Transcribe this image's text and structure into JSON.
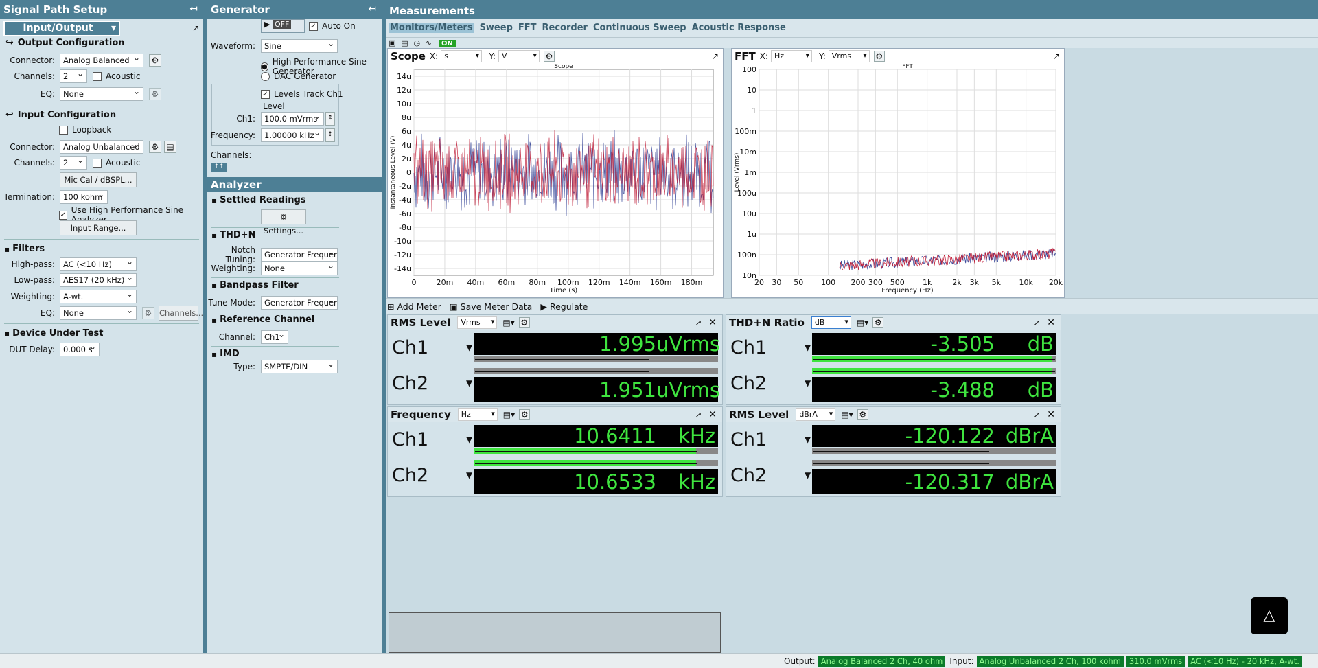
{
  "signal_path": {
    "title": "Signal Path Setup",
    "mode": "Input/Output",
    "output_config": {
      "title": "Output Configuration",
      "connector_label": "Connector:",
      "connector": "Analog Balanced",
      "channels_label": "Channels:",
      "channels": "2",
      "acoustic": "Acoustic",
      "eq_label": "EQ:",
      "eq": "None"
    },
    "input_config": {
      "title": "Input Configuration",
      "loopback": "Loopback",
      "connector_label": "Connector:",
      "connector": "Analog Unbalanced",
      "channels_label": "Channels:",
      "channels": "2",
      "acoustic": "Acoustic",
      "mic_cal": "Mic Cal / dBSPL...",
      "termination_label": "Termination:",
      "termination": "100 kohm",
      "hp_sine": "Use High Performance Sine Analyzer",
      "input_range": "Input Range..."
    },
    "filters": {
      "title": "Filters",
      "highpass_label": "High-pass:",
      "highpass": "AC (<10 Hz)",
      "lowpass_label": "Low-pass:",
      "lowpass": "AES17 (20 kHz)",
      "weighting_label": "Weighting:",
      "weighting": "A-wt.",
      "eq_label": "EQ:",
      "eq": "None",
      "channels_btn": "Channels..."
    },
    "dut": {
      "title": "Device Under Test",
      "delay_label": "DUT Delay:",
      "delay": "0.000 s"
    }
  },
  "generator": {
    "title": "Generator",
    "off": "OFF",
    "auto_on": "Auto On",
    "waveform_label": "Waveform:",
    "waveform": "Sine",
    "opt_hp": "High Performance Sine Generator",
    "opt_dac": "DAC Generator",
    "levels_track": "Levels Track Ch1",
    "level_label": "Level",
    "ch1_label": "Ch1:",
    "ch1": "100.0 mVrms",
    "freq_label": "Frequency:",
    "freq": "1.00000 kHz",
    "channels_label": "Channels:"
  },
  "analyzer": {
    "title": "Analyzer",
    "settled": "Settled Readings",
    "settings_btn": "Settings...",
    "thdn": "THD+N",
    "notch_label": "Notch Tuning:",
    "notch": "Generator Frequency",
    "weight_label": "Weighting:",
    "weight": "None",
    "bandpass": "Bandpass Filter",
    "tune_label": "Tune Mode:",
    "tune": "Generator Frequency",
    "ref": "Reference Channel",
    "ref_ch_label": "Channel:",
    "ref_ch": "Ch1",
    "imd": "IMD",
    "imd_type_label": "Type:",
    "imd_type": "SMPTE/DIN"
  },
  "measurements": {
    "title": "Measurements",
    "tabs": [
      "Monitors/Meters",
      "Sweep",
      "FFT",
      "Recorder",
      "Continuous Sweep",
      "Acoustic Response"
    ],
    "on_label": "ON",
    "add_meter": "Add Meter",
    "save_meter": "Save Meter Data",
    "regulate": "Regulate"
  },
  "scope": {
    "name": "Scope",
    "x_unit": "s",
    "y_unit": "V",
    "inner_title": "Scope",
    "xlabel": "Time (s)",
    "ylabel": "Instantaneous Level (V)",
    "yticks": [
      "14u",
      "12u",
      "10u",
      "8u",
      "6u",
      "4u",
      "2u",
      "0",
      "-2u",
      "-4u",
      "-6u",
      "-8u",
      "-10u",
      "-12u",
      "-14u"
    ],
    "xticks": [
      "0",
      "20m",
      "40m",
      "60m",
      "80m",
      "100m",
      "120m",
      "140m",
      "160m",
      "180m"
    ]
  },
  "fft": {
    "name": "FFT",
    "x_unit": "Hz",
    "y_unit": "Vrms",
    "inner_title": "FFT",
    "xlabel": "Frequency (Hz)",
    "ylabel": "Level (Vrms)",
    "yticks": [
      "100",
      "10",
      "1",
      "100m",
      "10m",
      "1m",
      "100u",
      "10u",
      "1u",
      "100n",
      "10n"
    ],
    "xticks": [
      "20",
      "30",
      "50",
      "100",
      "200",
      "300",
      "500",
      "1k",
      "2k",
      "3k",
      "5k",
      "10k",
      "20k"
    ]
  },
  "meters": [
    {
      "title": "RMS Level",
      "unit": "Vrms",
      "ch1": "1.995",
      "ch2": "1.951",
      "u": "uVrms",
      "fill1": 0,
      "fill2": 0,
      "line1": 0.71,
      "line2": 0.71
    },
    {
      "title": "THD+N Ratio",
      "unit": "dB",
      "ch1": "-3.505",
      "ch2": "-3.488",
      "u": "dB",
      "fill1": 0.98,
      "fill2": 0.98,
      "line1": 0.99,
      "line2": 0.99
    },
    {
      "title": "Frequency",
      "unit": "Hz",
      "ch1": "10.6411",
      "ch2": "10.6533",
      "u": "kHz",
      "fill1": 0.91,
      "fill2": 0.91,
      "line1": 0.91,
      "line2": 0.91
    },
    {
      "title": "RMS Level",
      "unit": "dBrA",
      "ch1": "-120.122",
      "ch2": "-120.317",
      "u": "dBrA",
      "fill1": 0,
      "fill2": 0,
      "line1": 0.72,
      "line2": 0.72
    }
  ],
  "ch_labels": {
    "ch1": "Ch1",
    "ch2": "Ch2"
  },
  "status": {
    "output_label": "Output:",
    "output": "Analog Balanced 2 Ch, 40 ohm",
    "input_label": "Input:",
    "input": "Analog Unbalanced 2 Ch, 100 kohm",
    "level": "310.0 mVrms",
    "filter": "AC (<10 Hz) - 20 kHz, A-wt."
  },
  "colors": {
    "header": "#4d7f95",
    "panel": "#d4e3ea",
    "meter_green": "#3fe43f",
    "trace_red": "#c0203a",
    "trace_blue": "#3b4a9a"
  }
}
